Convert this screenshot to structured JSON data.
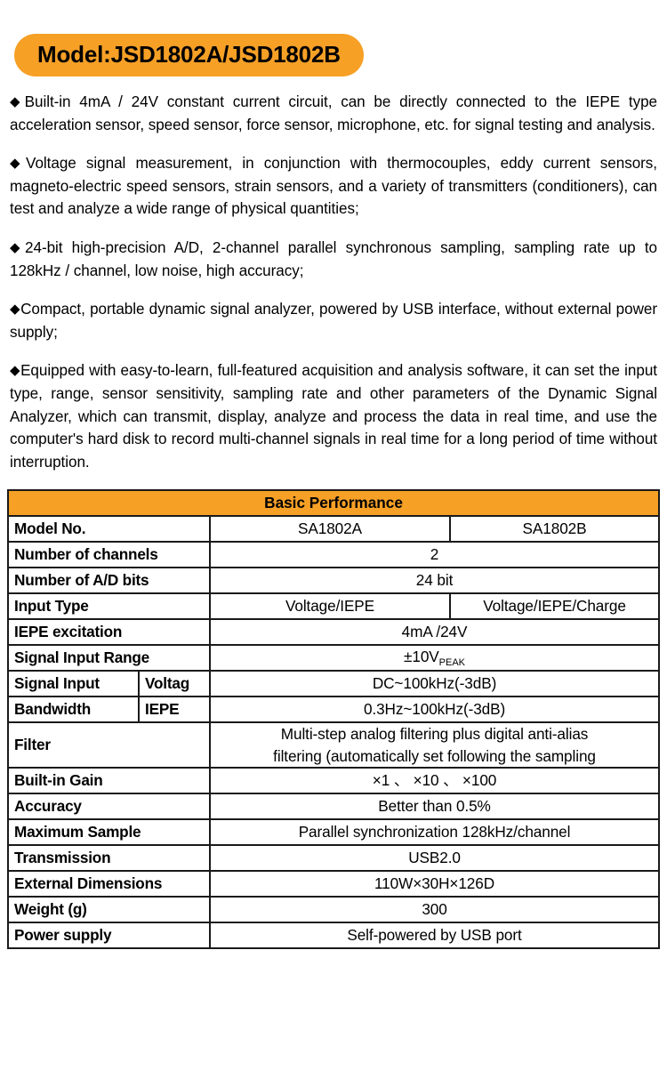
{
  "title_badge": {
    "text": "Model:JSD1802A/JSD1802B",
    "bg_color": "#F6A026"
  },
  "features": [
    {
      "bullet": "◆",
      "text": "Built-in 4mA / 24V constant current circuit, can be directly connected to the IEPE type acceleration sensor, speed sensor, force sensor, microphone, etc. for signal testing and analysis."
    },
    {
      "bullet": "◆",
      "text": "Voltage signal measurement, in conjunction with thermocouples, eddy current sensors, magneto-electric speed sensors, strain sensors, and a variety of transmitters (conditioners), can test and analyze a wide range of physical quantities;"
    },
    {
      "bullet": "◆",
      "text": "24-bit high-precision A/D, 2-channel parallel synchronous sampling, sampling rate up to 128kHz / channel, low noise, high accuracy;"
    },
    {
      "bullet": "◆",
      "text": "Compact, portable dynamic signal analyzer, powered by USB interface, without external power supply;"
    },
    {
      "bullet": "◆",
      "text": "Equipped with easy-to-learn, full-featured acquisition and analysis software, it can set the input type, range, sensor sensitivity, sampling rate and other parameters of the Dynamic Signal Analyzer, which can transmit, display, analyze and process the data in real time, and use the computer's hard disk to record multi-channel signals in real time for a long period of time without interruption."
    }
  ],
  "spec_table": {
    "header": "Basic Performance",
    "header_bg": "#F6A026",
    "rows": {
      "model_no": {
        "label": "Model No.",
        "value_a": "SA1802A",
        "value_b": "SA1802B"
      },
      "channels": {
        "label": "Number of channels",
        "value": "2"
      },
      "ad_bits": {
        "label": "Number of A/D bits",
        "value": "24 bit"
      },
      "input_type": {
        "label": "Input Type",
        "value_a": "Voltage/IEPE",
        "value_b": "Voltage/IEPE/Charge"
      },
      "iepe_excitation": {
        "label": "IEPE excitation",
        "value": "4mA /24V"
      },
      "signal_input_range": {
        "label": "Signal Input Range",
        "value_main": "±10V",
        "value_sub": "PEAK"
      },
      "bandwidth": {
        "label_line1": "Signal Input",
        "label_line2": "Bandwidth",
        "sub_voltage_label": "Voltag",
        "sub_voltage_value": "DC~100kHz(-3dB)",
        "sub_iepe_label": "IEPE",
        "sub_iepe_value": "0.3Hz~100kHz(-3dB)"
      },
      "filter": {
        "label": "Filter",
        "value_line1": "Multi-step analog filtering plus digital anti-alias",
        "value_line2": "filtering (automatically set following the sampling"
      },
      "gain": {
        "label": "Built-in Gain",
        "value": "×1 、 ×10 、 ×100"
      },
      "accuracy": {
        "label": "Accuracy",
        "value": "Better than 0.5%"
      },
      "max_sample": {
        "label": "Maximum Sample",
        "value": "Parallel synchronization 128kHz/channel"
      },
      "transmission": {
        "label": "Transmission",
        "value": "USB2.0"
      },
      "dimensions": {
        "label": "External Dimensions",
        "value": "110W×30H×126D"
      },
      "weight": {
        "label": "Weight (g)",
        "value": "300"
      },
      "power": {
        "label": "Power supply",
        "value": "Self-powered by USB port"
      }
    }
  }
}
